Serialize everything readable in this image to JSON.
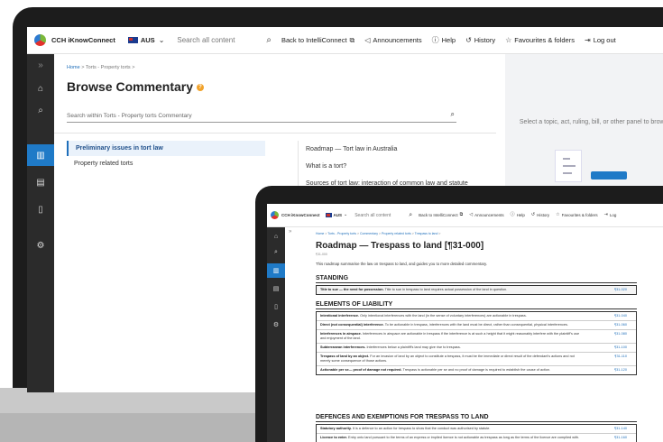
{
  "colors": {
    "accent": "#1f7ac7",
    "sidebar": "#2b2b2b",
    "link": "#1f6fba",
    "qicon": "#f1a22a"
  },
  "back_window": {
    "topbar": {
      "brand": "CCH iKnowConnect",
      "region": "AUS",
      "search_placeholder": "Search all content",
      "back": "Back to IntelliConnect",
      "announcements": "Announcements",
      "help": "Help",
      "history": "History",
      "favourites": "Favourites & folders",
      "logout": "Log out"
    },
    "breadcrumb": {
      "home": "Home",
      "sep": ">",
      "path": "Torts - Property torts"
    },
    "title": "Browse Commentary",
    "search_placeholder": "Search within Torts - Property torts Commentary",
    "topics": [
      "Preliminary issues in tort law",
      "Property related torts"
    ],
    "subtopics": [
      "Roadmap — Tort law in Australia",
      "What is a tort?",
      "Sources of tort law: interaction of common law and statute"
    ],
    "right_panel_text": "Select a topic, act, ruling, bill, or other panel to brows"
  },
  "front_window": {
    "topbar": {
      "brand": "CCH iKnowConnect",
      "region": "AUS",
      "search_placeholder": "Search all content",
      "back": "Back to IntelliConnect",
      "announcements": "Announcements",
      "help": "Help",
      "history": "History",
      "favourites": "Favourites & folders",
      "logout": "Log"
    },
    "breadcrumb": {
      "home": "Home",
      "p1": "Torts - Property torts",
      "p2": "Commentary",
      "p3": "Property related torts",
      "p4": "Trespass to land"
    },
    "title": "Roadmap — Trespass to land [¶31-000]",
    "para": "¶31-000",
    "intro": "This roadmap summarise the law on trespass to land, and guides you to more detailed commentary.",
    "standing": {
      "heading": "STANDING",
      "rows": [
        {
          "bold": "Title to sue — the need for possession.",
          "text": "Title to sue in trespass to land requires actual possession of the land in question.",
          "ref": "¶31-020"
        }
      ]
    },
    "elements": {
      "heading": "ELEMENTS OF LIABILITY",
      "rows": [
        {
          "bold": "Intentional interference.",
          "text": "Only intentional interferences with the land (in the sense of voluntary interferences) are actionable in trespass.",
          "ref": "¶31-040"
        },
        {
          "bold": "Direct (not consequential) interference.",
          "text": "To be actionable in trespass, interferences with the land must be direct, rather than consequential, physical interferences.",
          "ref": "¶31-060"
        },
        {
          "bold": "Interferences in airspace.",
          "text": "Interferences in airspace are actionable in trespass if the interference is at such a height that it might reasonably interfere with the plaintiff's use and enjoyment of the land.",
          "ref": "¶31-080"
        },
        {
          "bold": "Subterranean interferences.",
          "text": "Interferences below a plaintiff's land may give rise to trespass.",
          "ref": "¶31-100"
        },
        {
          "bold": "Trespass of land by an object.",
          "text": "For an invasion of land by an object to constitute a trespass, it must be the immediate or direct result of the defendant's actions and not merely some consequence of those actions.",
          "ref": "¶31-110"
        },
        {
          "bold": "Actionable per se— proof of damage not required.",
          "text": "Trespass is actionable per se and no proof of damage is required to establish the cause of action.",
          "ref": "¶31-120"
        }
      ]
    },
    "defences": {
      "heading": "DEFENCES AND EXEMPTIONS FOR TRESPASS TO LAND",
      "rows": [
        {
          "bold": "Statutory authority.",
          "text": "It is a defence to an action for trespass to show that the conduct was authorised by statute.",
          "ref": "¶31-140"
        },
        {
          "bold": "Licence to enter.",
          "text": "Entry onto land pursuant to the terms of an express or implied licence is not actionable as trespass as long as the terms of the licence are complied with.",
          "ref": "¶31-160"
        }
      ]
    }
  }
}
